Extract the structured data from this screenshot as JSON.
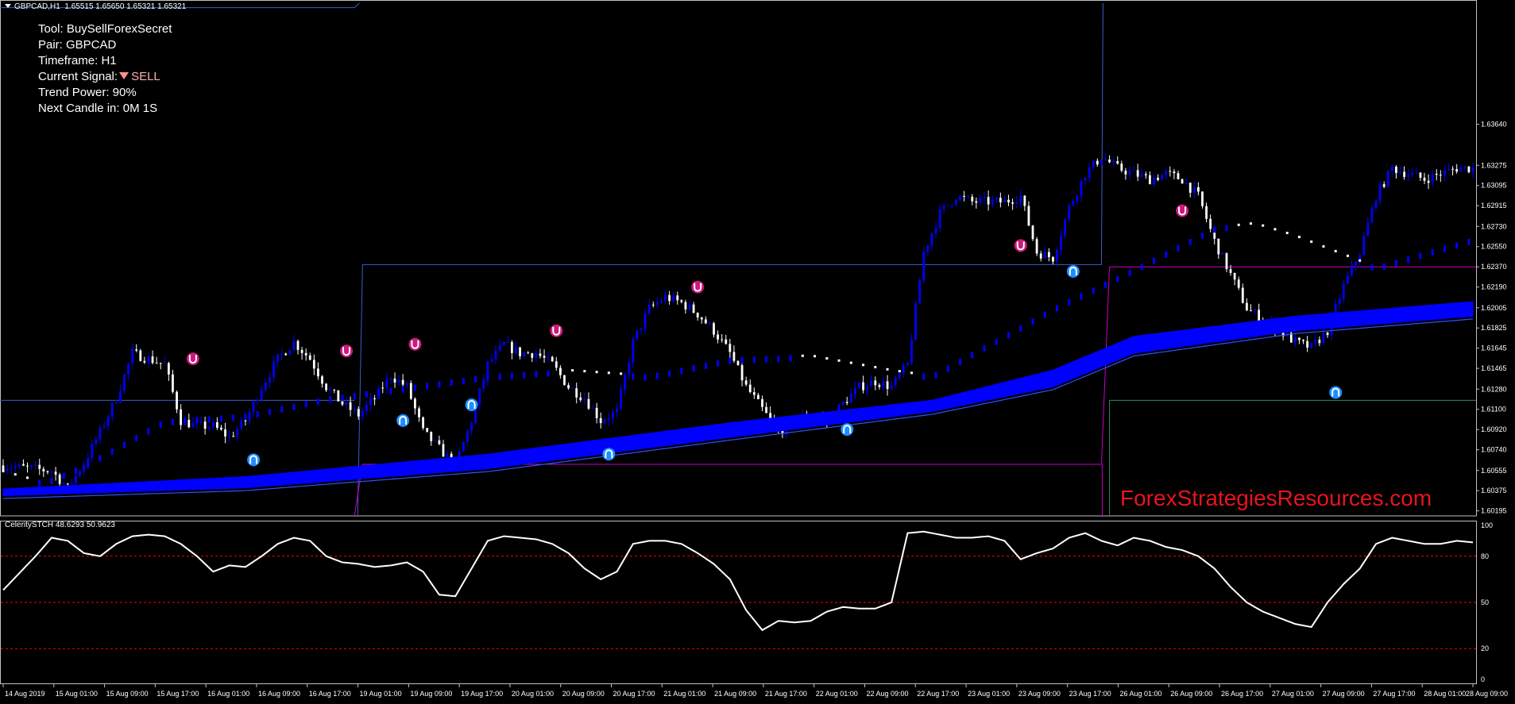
{
  "header": {
    "symbol": "GBPCAD,H1",
    "ohlc": "1.65515 1.65650 1.65321 1.65321"
  },
  "info": {
    "tool": "Tool: BuySellForexSecret",
    "pair": "Pair: GBPCAD",
    "timeframe": "Timeframe: H1",
    "signal_label": "Current Signal:",
    "signal_value": "SELL",
    "trend_power": "Trend Power: 90%",
    "next_candle": "Next Candle in: 0M 1S"
  },
  "watermark": "ForexStrategiesResources.com",
  "colors": {
    "background": "#000000",
    "bull_candle": "#0000ff",
    "bear_candle": "#ffffff",
    "ribbon": "#0000ff",
    "buy_arrow": "#1e8fff",
    "sell_arrow": "#cc1a7a",
    "magenta_line": "#c800c8",
    "blue_level": "#3a5fcd",
    "teal_level": "#2e8b57",
    "osc_line": "#ffffff",
    "osc_level": "#ff0000"
  },
  "chart_data": [
    {
      "type": "candlestick",
      "title": "GBPCAD,H1",
      "yaxis_ticks": [
        "1.63640",
        "1.63275",
        "1.63095",
        "1.62915",
        "1.62730",
        "1.62550",
        "1.62370",
        "1.62190",
        "1.62005",
        "1.61825",
        "1.61645",
        "1.61465",
        "1.61280",
        "1.61100",
        "1.60920",
        "1.60740",
        "1.60555",
        "1.60375",
        "1.60195"
      ],
      "ylim": [
        1.6015,
        1.6472
      ],
      "xaxis_ticks": [
        "14 Aug 2019",
        "15 Aug 01:00",
        "15 Aug 09:00",
        "15 Aug 17:00",
        "16 Aug 01:00",
        "16 Aug 09:00",
        "16 Aug 17:00",
        "19 Aug 01:00",
        "19 Aug 09:00",
        "19 Aug 17:00",
        "20 Aug 01:00",
        "20 Aug 09:00",
        "20 Aug 17:00",
        "21 Aug 01:00",
        "21 Aug 09:00",
        "21 Aug 17:00",
        "22 Aug 01:00",
        "22 Aug 09:00",
        "22 Aug 17:00",
        "23 Aug 01:00",
        "23 Aug 09:00",
        "23 Aug 17:00",
        "26 Aug 01:00",
        "26 Aug 09:00",
        "26 Aug 17:00",
        "27 Aug 01:00",
        "27 Aug 09:00",
        "27 Aug 17:00",
        "28 Aug 01:00",
        "28 Aug 09:00"
      ],
      "close_path": [
        [
          0,
          1.606
        ],
        [
          12,
          1.6055
        ],
        [
          16,
          1.604
        ],
        [
          20,
          1.6062
        ],
        [
          24,
          1.609
        ],
        [
          28,
          1.612
        ],
        [
          32,
          1.616
        ],
        [
          36,
          1.6155
        ],
        [
          40,
          1.615
        ],
        [
          44,
          1.61
        ],
        [
          48,
          1.6095
        ],
        [
          52,
          1.6095
        ],
        [
          56,
          1.6085
        ],
        [
          60,
          1.61
        ],
        [
          64,
          1.613
        ],
        [
          68,
          1.6155
        ],
        [
          72,
          1.617
        ],
        [
          76,
          1.6155
        ],
        [
          80,
          1.613
        ],
        [
          84,
          1.6115
        ],
        [
          88,
          1.6105
        ],
        [
          92,
          1.612
        ],
        [
          96,
          1.614
        ],
        [
          100,
          1.613
        ],
        [
          104,
          1.609
        ],
        [
          108,
          1.6075
        ],
        [
          112,
          1.606
        ],
        [
          116,
          1.61
        ],
        [
          120,
          1.615
        ],
        [
          124,
          1.6168
        ],
        [
          128,
          1.616
        ],
        [
          132,
          1.616
        ],
        [
          136,
          1.615
        ],
        [
          140,
          1.613
        ],
        [
          144,
          1.612
        ],
        [
          148,
          1.61
        ],
        [
          152,
          1.6108
        ],
        [
          156,
          1.617
        ],
        [
          160,
          1.62
        ],
        [
          164,
          1.621
        ],
        [
          168,
          1.6205
        ],
        [
          172,
          1.6195
        ],
        [
          176,
          1.618
        ],
        [
          180,
          1.616
        ],
        [
          184,
          1.613
        ],
        [
          188,
          1.611
        ],
        [
          192,
          1.609
        ],
        [
          196,
          1.61
        ],
        [
          200,
          1.6105
        ],
        [
          204,
          1.61
        ],
        [
          208,
          1.6115
        ],
        [
          212,
          1.613
        ],
        [
          216,
          1.6135
        ],
        [
          220,
          1.613
        ],
        [
          224,
          1.615
        ],
        [
          228,
          1.625
        ],
        [
          232,
          1.6285
        ],
        [
          236,
          1.63
        ],
        [
          240,
          1.6295
        ],
        [
          244,
          1.6295
        ],
        [
          248,
          1.6295
        ],
        [
          252,
          1.63
        ],
        [
          256,
          1.625
        ],
        [
          260,
          1.6245
        ],
        [
          264,
          1.629
        ],
        [
          268,
          1.632
        ],
        [
          272,
          1.6335
        ],
        [
          276,
          1.6325
        ],
        [
          280,
          1.632
        ],
        [
          284,
          1.6315
        ],
        [
          288,
          1.632
        ],
        [
          292,
          1.6315
        ],
        [
          296,
          1.63
        ],
        [
          300,
          1.626
        ],
        [
          304,
          1.623
        ],
        [
          308,
          1.62
        ],
        [
          312,
          1.619
        ],
        [
          316,
          1.618
        ],
        [
          320,
          1.617
        ],
        [
          324,
          1.6165
        ],
        [
          328,
          1.618
        ],
        [
          332,
          1.622
        ],
        [
          336,
          1.625
        ],
        [
          340,
          1.63
        ],
        [
          344,
          1.6325
        ],
        [
          348,
          1.632
        ],
        [
          352,
          1.6315
        ],
        [
          356,
          1.632
        ],
        [
          360,
          1.6325
        ],
        [
          364,
          1.6325
        ]
      ],
      "candle_count": 365,
      "ribbon_upper": [
        [
          0,
          1.6039
        ],
        [
          60,
          1.605
        ],
        [
          120,
          1.607
        ],
        [
          180,
          1.6098
        ],
        [
          230,
          1.6118
        ],
        [
          260,
          1.6145
        ],
        [
          280,
          1.6175
        ],
        [
          320,
          1.6193
        ],
        [
          364,
          1.6206
        ]
      ],
      "ribbon_lower": [
        [
          0,
          1.6033
        ],
        [
          60,
          1.604
        ],
        [
          120,
          1.6057
        ],
        [
          180,
          1.6085
        ],
        [
          230,
          1.6108
        ],
        [
          260,
          1.613
        ],
        [
          280,
          1.616
        ],
        [
          320,
          1.618
        ],
        [
          364,
          1.6193
        ]
      ],
      "trend_line": [
        [
          0,
          1.6055
        ],
        [
          10,
          1.6045
        ],
        [
          20,
          1.606
        ],
        [
          40,
          1.61
        ],
        [
          60,
          1.6105
        ],
        [
          80,
          1.612
        ],
        [
          100,
          1.613
        ],
        [
          120,
          1.614
        ],
        [
          140,
          1.6145
        ],
        [
          160,
          1.614
        ],
        [
          180,
          1.6155
        ],
        [
          200,
          1.6158
        ],
        [
          220,
          1.6145
        ],
        [
          230,
          1.614
        ],
        [
          240,
          1.616
        ],
        [
          260,
          1.62
        ],
        [
          280,
          1.6235
        ],
        [
          300,
          1.6272
        ],
        [
          310,
          1.6276
        ],
        [
          320,
          1.6265
        ],
        [
          340,
          1.6237
        ],
        [
          364,
          1.6262
        ]
      ],
      "buy_arrows": [
        [
          62,
          1.6065
        ],
        [
          99,
          1.61
        ],
        [
          116,
          1.6114
        ],
        [
          150,
          1.607
        ],
        [
          209,
          1.6092
        ],
        [
          265,
          1.6233
        ],
        [
          330,
          1.6125
        ]
      ],
      "sell_arrows": [
        [
          47,
          1.6155
        ],
        [
          85,
          1.6162
        ],
        [
          102,
          1.6168
        ],
        [
          137,
          1.618
        ],
        [
          172,
          1.6219
        ],
        [
          252,
          1.6256
        ],
        [
          292,
          1.6287
        ]
      ],
      "magenta_level": {
        "upper": 1.6237,
        "lower": 1.6061
      },
      "blue_level": {
        "upper": 1.6239,
        "lower": 1.6118
      },
      "teal_level": 1.6118
    },
    {
      "type": "line",
      "title": "CeleritySTCH 48.6293 50.9623",
      "yaxis_ticks": [
        "100",
        "80",
        "50",
        "20",
        "0"
      ],
      "ylim": [
        0,
        100
      ],
      "levels": [
        20,
        50,
        80
      ],
      "series": [
        {
          "values": [
            [
              0,
              58
            ],
            [
              8,
              80
            ],
            [
              12,
              92
            ],
            [
              16,
              90
            ],
            [
              20,
              82
            ],
            [
              24,
              80
            ],
            [
              28,
              88
            ],
            [
              32,
              93
            ],
            [
              36,
              94
            ],
            [
              40,
              93
            ],
            [
              44,
              88
            ],
            [
              48,
              80
            ],
            [
              52,
              70
            ],
            [
              56,
              74
            ],
            [
              60,
              73
            ],
            [
              64,
              80
            ],
            [
              68,
              88
            ],
            [
              72,
              92
            ],
            [
              76,
              90
            ],
            [
              80,
              80
            ],
            [
              84,
              76
            ],
            [
              88,
              75
            ],
            [
              92,
              73
            ],
            [
              96,
              74
            ],
            [
              100,
              76
            ],
            [
              104,
              70
            ],
            [
              108,
              55
            ],
            [
              112,
              54
            ],
            [
              116,
              72
            ],
            [
              120,
              90
            ],
            [
              124,
              93
            ],
            [
              128,
              92
            ],
            [
              132,
              91
            ],
            [
              136,
              88
            ],
            [
              140,
              82
            ],
            [
              144,
              72
            ],
            [
              148,
              65
            ],
            [
              152,
              70
            ],
            [
              156,
              88
            ],
            [
              160,
              90
            ],
            [
              164,
              90
            ],
            [
              168,
              88
            ],
            [
              172,
              82
            ],
            [
              176,
              75
            ],
            [
              180,
              65
            ],
            [
              184,
              45
            ],
            [
              188,
              32
            ],
            [
              192,
              38
            ],
            [
              196,
              37
            ],
            [
              200,
              38
            ],
            [
              204,
              44
            ],
            [
              208,
              47
            ],
            [
              212,
              46
            ],
            [
              216,
              46
            ],
            [
              220,
              50
            ],
            [
              224,
              95
            ],
            [
              228,
              96
            ],
            [
              232,
              94
            ],
            [
              236,
              92
            ],
            [
              240,
              92
            ],
            [
              244,
              93
            ],
            [
              248,
              90
            ],
            [
              252,
              78
            ],
            [
              256,
              82
            ],
            [
              260,
              85
            ],
            [
              264,
              92
            ],
            [
              268,
              95
            ],
            [
              272,
              90
            ],
            [
              276,
              87
            ],
            [
              280,
              92
            ],
            [
              284,
              90
            ],
            [
              288,
              86
            ],
            [
              292,
              84
            ],
            [
              296,
              80
            ],
            [
              300,
              72
            ],
            [
              304,
              60
            ],
            [
              308,
              50
            ],
            [
              312,
              44
            ],
            [
              316,
              40
            ],
            [
              320,
              36
            ],
            [
              324,
              34
            ],
            [
              328,
              50
            ],
            [
              332,
              62
            ],
            [
              336,
              72
            ],
            [
              340,
              88
            ],
            [
              344,
              92
            ],
            [
              348,
              90
            ],
            [
              352,
              88
            ],
            [
              356,
              88
            ],
            [
              360,
              90
            ],
            [
              364,
              89
            ]
          ]
        }
      ]
    }
  ]
}
